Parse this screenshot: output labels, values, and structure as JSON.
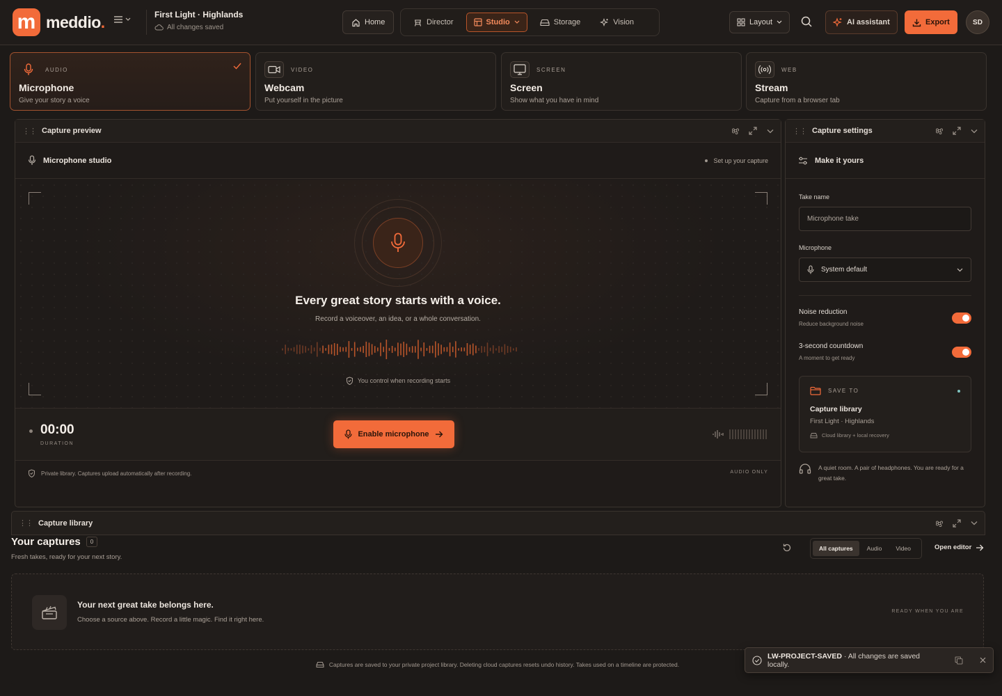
{
  "app": {
    "logo_letter": "m",
    "logo_name": "meddio",
    "logo_dot": ".",
    "accent": "#f26b3a"
  },
  "project": {
    "title": "First Light · Highlands",
    "status": "All changes saved"
  },
  "nav": {
    "home": "Home",
    "items": [
      "Director",
      "Studio",
      "Storage",
      "Vision"
    ],
    "active": "Studio"
  },
  "toolbar": {
    "layout": "Layout",
    "ai": "AI assistant",
    "export": "Export",
    "avatar": "SD"
  },
  "sources": [
    {
      "kind": "AUDIO",
      "name": "Microphone",
      "desc": "Give your story a voice",
      "icon": "microphone-icon",
      "selected": true
    },
    {
      "kind": "VIDEO",
      "name": "Webcam",
      "desc": "Put yourself in the picture",
      "icon": "video-camera-icon",
      "selected": false
    },
    {
      "kind": "SCREEN",
      "name": "Screen",
      "desc": "Show what you have in mind",
      "icon": "monitor-icon",
      "selected": false
    },
    {
      "kind": "WEB",
      "name": "Stream",
      "desc": "Capture from a browser tab",
      "icon": "broadcast-icon",
      "selected": false
    }
  ],
  "preview": {
    "title": "Capture preview",
    "studio": "Microphone studio",
    "status": "Set up your capture",
    "headline": "Every great story starts with a voice.",
    "subline": "Record a voiceover, an idea, or a whole conversation.",
    "control_note": "You control when recording starts",
    "duration": "00:00",
    "duration_label": "DURATION",
    "enable_button": "Enable microphone",
    "footer_note": "Private library. Captures upload automatically after recording.",
    "footer_tag": "AUDIO ONLY"
  },
  "settings": {
    "title": "Capture settings",
    "section": "Make it yours",
    "take_label": "Take name",
    "take_placeholder": "Microphone take",
    "mic_label": "Microphone",
    "mic_value": "System default",
    "noise_title": "Noise reduction",
    "noise_sub": "Reduce background noise",
    "noise_on": true,
    "countdown_title": "3-second countdown",
    "countdown_sub": "A moment to get ready",
    "countdown_on": true,
    "save_kind": "SAVE TO",
    "save_name": "Capture library",
    "save_project": "First Light · Highlands",
    "save_note": "Cloud library + local recovery",
    "tip": "A quiet room. A pair of headphones. You are ready for a great take."
  },
  "library": {
    "title": "Capture library",
    "heading": "Your captures",
    "count": "0",
    "sub": "Fresh takes, ready for your next story.",
    "tabs": [
      "All captures",
      "Audio",
      "Video"
    ],
    "active_tab": "All captures",
    "open_editor": "Open editor",
    "empty_title": "Your next great take belongs here.",
    "empty_sub": "Choose a source above. Record a little magic. Find it right here.",
    "empty_tag": "READY WHEN YOU ARE",
    "note": "Captures are saved to your private project library. Deleting cloud captures resets undo history. Takes used on a timeline are protected."
  },
  "toast": {
    "code": "LW-PROJECT-SAVED",
    "message": "· All changes are saved locally."
  }
}
